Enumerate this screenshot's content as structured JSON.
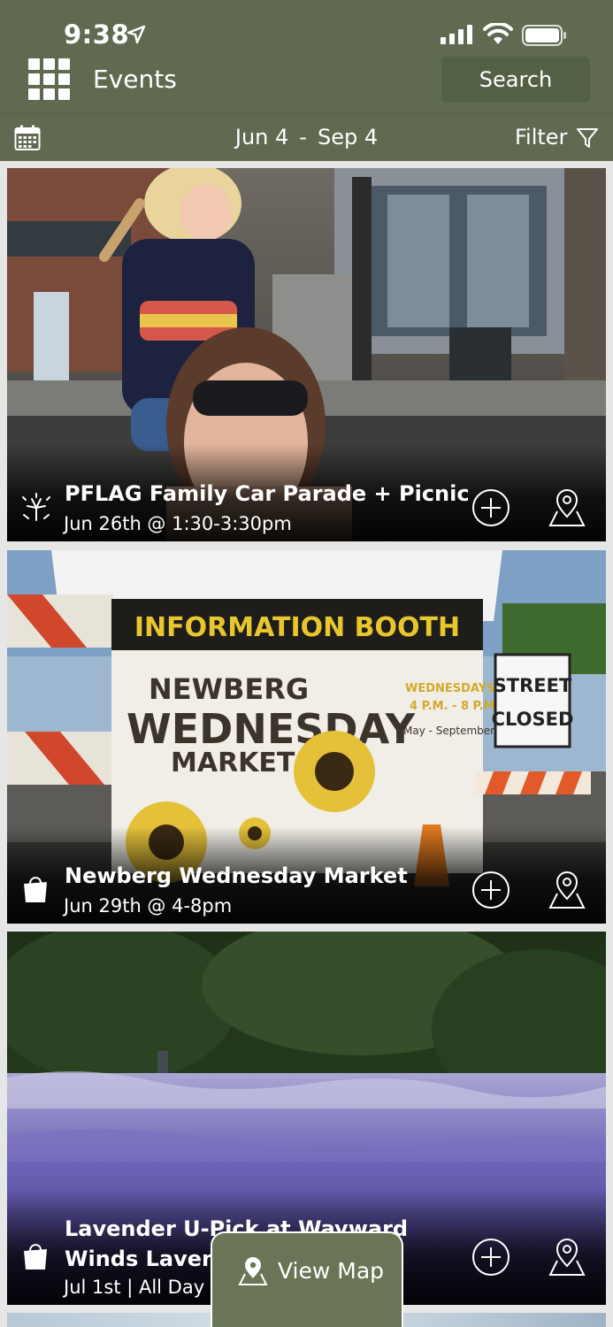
{
  "status_bar": {
    "time": "9:38"
  },
  "header": {
    "title": "Events",
    "search_label": "Search",
    "menu_icon": "grid-menu-icon"
  },
  "date_bar": {
    "start": "Jun 4",
    "separator": "-",
    "end": "Sep 4",
    "filter_label": "Filter"
  },
  "events": [
    {
      "title": "PFLAG Family Car Parade + Picnic",
      "date": "Jun 26th @ 1:30-3:30pm",
      "category_icon": "fireworks-icon"
    },
    {
      "title": "Newberg Wednesday Market",
      "date": "Jun 29th @ 4-8pm",
      "category_icon": "shopping-bag-icon",
      "image_text": {
        "banner_top": "INFORMATION BOOTH",
        "line1": "NEWBERG",
        "line2": "WEDNESDAY",
        "line3": "MARKET",
        "side1": "WEDNESDAYS",
        "side2": "4 P.M. - 8 P.M.",
        "side3": "May - September",
        "sign1": "STREET",
        "sign2": "CLOSED"
      }
    },
    {
      "title_line1": "Lavender U-Pick at Wayward",
      "title_line2": "Winds Lavenc",
      "date": "Jul 1st | All Day",
      "category_icon": "shopping-bag-icon"
    }
  ],
  "view_map": {
    "label": "View Map"
  },
  "colors": {
    "header": "#5f6a50",
    "search_button": "#536045",
    "view_map": "#6a7456"
  }
}
